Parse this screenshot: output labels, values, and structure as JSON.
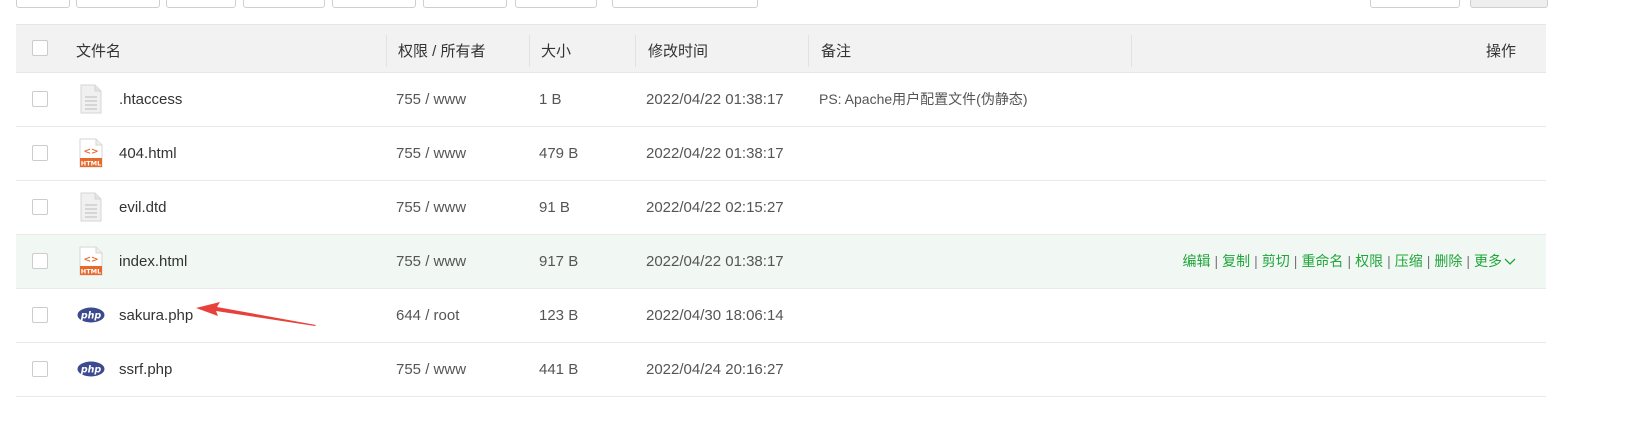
{
  "table": {
    "headers": {
      "name": "文件名",
      "permission": "权限 / 所有者",
      "size": "大小",
      "modified": "修改时间",
      "note": "备注",
      "actions": "操作"
    },
    "rows": [
      {
        "icon": "file-icon",
        "name": ".htaccess",
        "permission": "755 / www",
        "size": "1 B",
        "modified": "2022/04/22 01:38:17",
        "note": "PS: Apache用户配置文件(伪静态)"
      },
      {
        "icon": "html-file-icon",
        "name": "404.html",
        "permission": "755 / www",
        "size": "479 B",
        "modified": "2022/04/22 01:38:17",
        "note": ""
      },
      {
        "icon": "file-icon",
        "name": "evil.dtd",
        "permission": "755 / www",
        "size": "91 B",
        "modified": "2022/04/22 02:15:27",
        "note": ""
      },
      {
        "icon": "html-file-icon",
        "name": "index.html",
        "permission": "755 / www",
        "size": "917 B",
        "modified": "2022/04/22 01:38:17",
        "note": ""
      },
      {
        "icon": "php-file-icon",
        "name": "sakura.php",
        "permission": "644 / root",
        "size": "123 B",
        "modified": "2022/04/30 18:06:14",
        "note": ""
      },
      {
        "icon": "php-file-icon",
        "name": "ssrf.php",
        "permission": "755 / www",
        "size": "441 B",
        "modified": "2022/04/24 20:16:27",
        "note": ""
      }
    ],
    "hover_actions": {
      "edit": "编辑",
      "copy": "复制",
      "cut": "剪切",
      "rename": "重命名",
      "permission": "权限",
      "compress": "压缩",
      "delete": "删除",
      "more": "更多",
      "separator": "|"
    }
  },
  "icons": {
    "html_badge": "HTML",
    "html_symbol": "<>",
    "php_badge": "php"
  },
  "colors": {
    "action_link": "#20a53a",
    "header_bg": "#f2f2f2",
    "hover_row_bg": "#f1f8f4",
    "arrow": "#e8413b",
    "html_icon": "#e8692c",
    "php_icon": "#3c4a8f"
  }
}
